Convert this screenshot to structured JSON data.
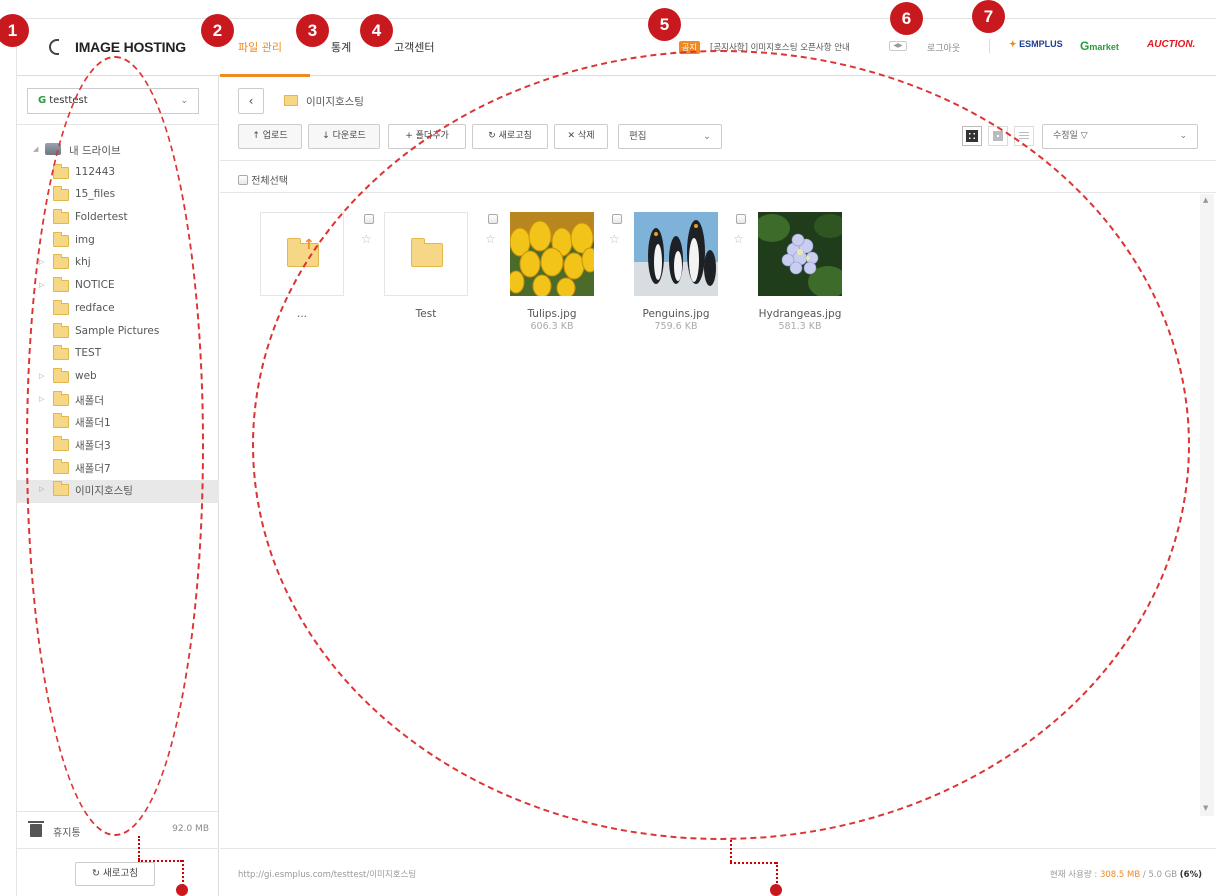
{
  "header": {
    "logo": "IMAGE HOSTING",
    "tabs": [
      "파일 관리",
      "통계",
      "고객센터"
    ],
    "notice_badge": "공지",
    "notice_text": "[공지사항] 이미지호스팅 오픈사항 안내",
    "logout": "로그아웃",
    "brands": {
      "esmplus": "ESMPLUS",
      "gmarket_g": "G",
      "gmarket": "market",
      "auction": "AUCTION."
    }
  },
  "sidebar": {
    "account": "testtest",
    "account_prefix": "G",
    "root": "내 드라이브",
    "folders": [
      "112443",
      "15_files",
      "Foldertest",
      "img",
      "khj",
      "NOTICE",
      "redface",
      "Sample Pictures",
      "TEST",
      "web",
      "새폴더",
      "새폴더1",
      "새폴더3",
      "새폴더7",
      "이미지호스팅"
    ],
    "trash_label": "휴지통",
    "trash_size": "92.0 MB",
    "refresh_label": "새로고침"
  },
  "main": {
    "breadcrumb": "이미지호스팅",
    "toolbar": {
      "upload": "↑ 업로드",
      "download": "↓ 다운로드",
      "add_folder": "+ 폴더추가",
      "refresh": "↻ 새로고침",
      "delete": "✕ 삭제",
      "edit": "편집",
      "sort": "수정일 ▽"
    },
    "select_all": "전체선택",
    "files": [
      {
        "name": "...",
        "size": "",
        "type": "parent"
      },
      {
        "name": "Test",
        "size": "",
        "type": "folder"
      },
      {
        "name": "Tulips.jpg",
        "size": "606.3 KB",
        "type": "image"
      },
      {
        "name": "Penguins.jpg",
        "size": "759.6 KB",
        "type": "image"
      },
      {
        "name": "Hydrangeas.jpg",
        "size": "581.3 KB",
        "type": "image"
      }
    ],
    "footer_url": "http://gi.esmplus.com/testtest/이미지호스팅",
    "usage_label": "현재 사용량 : ",
    "usage_used": "308.5 MB",
    "usage_total": " / 5.0 GB ",
    "usage_pct": "(6%)"
  },
  "annotations": [
    "1",
    "2",
    "3",
    "4",
    "5",
    "6",
    "7"
  ],
  "colors": {
    "accent": "#f08a23",
    "annotation": "#c8191f"
  }
}
